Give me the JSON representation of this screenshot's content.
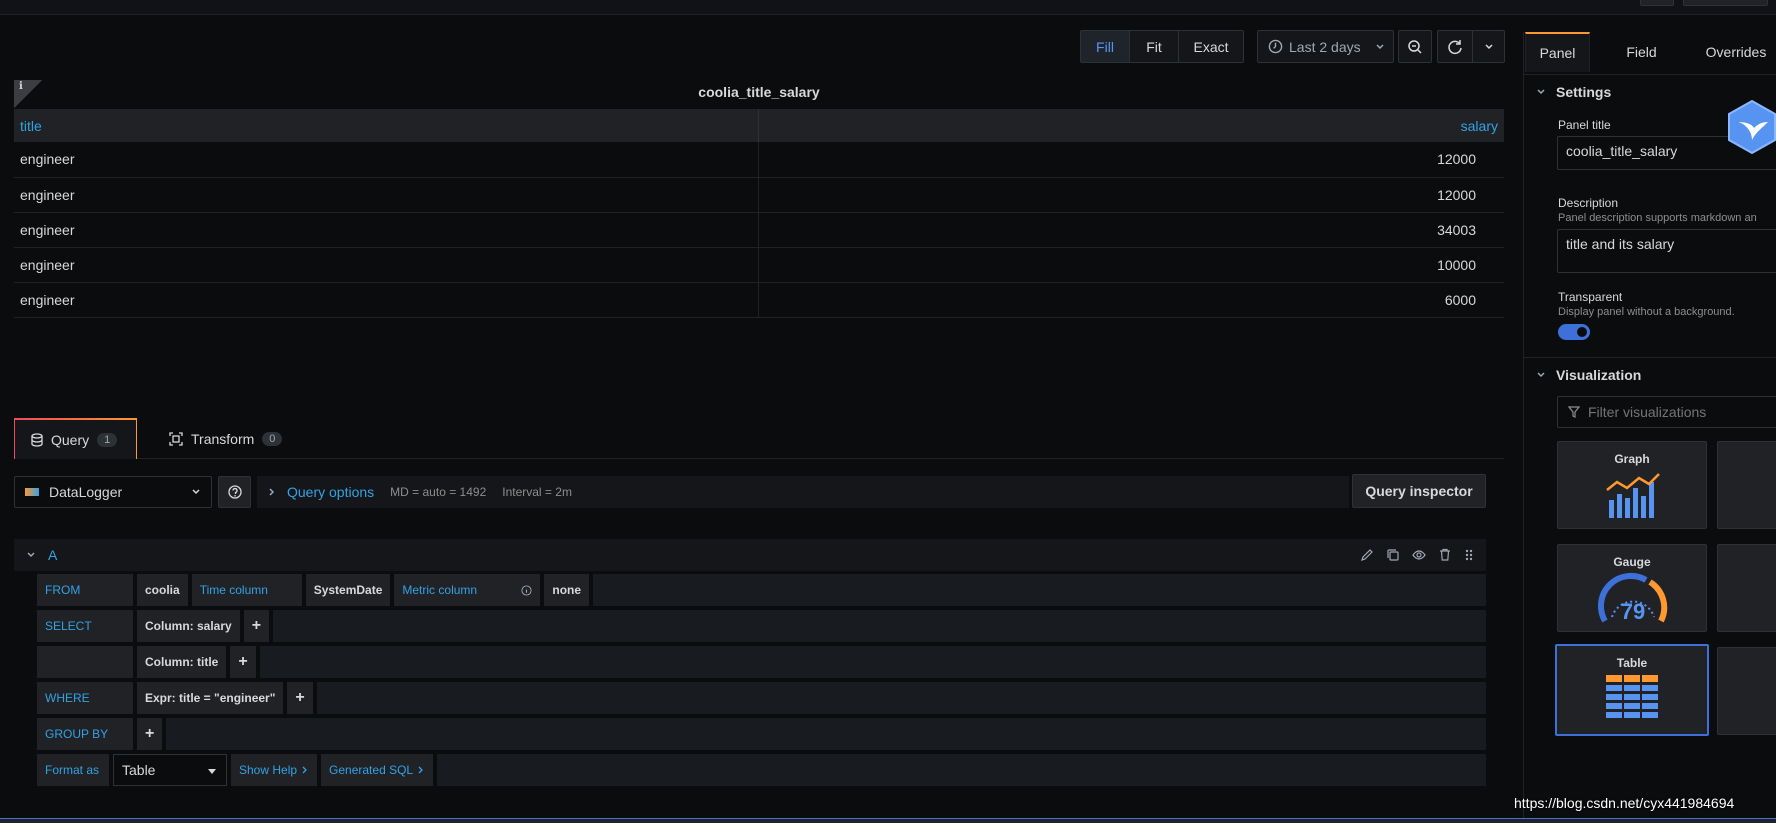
{
  "toolbar": {
    "fill": "Fill",
    "fit": "Fit",
    "exact": "Exact",
    "time_range": "Last 2 days"
  },
  "panel": {
    "title": "coolia_title_salary",
    "info_glyph": "i",
    "columns": [
      "title",
      "salary"
    ],
    "rows": [
      [
        "engineer",
        "12000"
      ],
      [
        "engineer",
        "12000"
      ],
      [
        "engineer",
        "34003"
      ],
      [
        "engineer",
        "10000"
      ],
      [
        "engineer",
        "6000"
      ]
    ]
  },
  "tabs": {
    "query": {
      "label": "Query",
      "count": "1"
    },
    "transform": {
      "label": "Transform",
      "count": "0"
    }
  },
  "query_editor": {
    "datasource": "DataLogger",
    "query_options_label": "Query options",
    "md": "MD = auto = 1492",
    "interval": "Interval = 2m",
    "query_inspector": "Query inspector",
    "query_ref": "A",
    "from_kw": "FROM",
    "from_table": "coolia",
    "time_column_kw": "Time column",
    "time_column": "SystemDate",
    "metric_column_kw": "Metric column",
    "metric_column": "none",
    "select_kw": "SELECT",
    "select_col1": "Column: salary",
    "select_col2": "Column: title",
    "where_kw": "WHERE",
    "where_expr": "Expr: title = \"engineer\"",
    "groupby_kw": "GROUP BY",
    "format_kw": "Format as",
    "format_value": "Table",
    "show_help": "Show Help",
    "generated_sql": "Generated SQL",
    "plus": "+"
  },
  "sidebar": {
    "tabs": [
      "Panel",
      "Field",
      "Overrides"
    ],
    "settings": "Settings",
    "panel_title_label": "Panel title",
    "panel_title_value": "coolia_title_salary",
    "description_label": "Description",
    "description_hint": "Panel description supports markdown an",
    "description_value": "title and its salary",
    "transparent_label": "Transparent",
    "transparent_hint": "Display panel without a background.",
    "transparent_on": true,
    "visualization": "Visualization",
    "filter_placeholder": "Filter visualizations",
    "viz": [
      "Graph",
      "Gauge",
      "Table"
    ],
    "gauge_value": "79",
    "selected_viz": "Table"
  },
  "watermark": "https://blog.csdn.net/cyx441984694",
  "colors": {
    "accent_blue": "#33a2e5",
    "link_blue": "#5794f2",
    "orange": "#ff9830"
  }
}
